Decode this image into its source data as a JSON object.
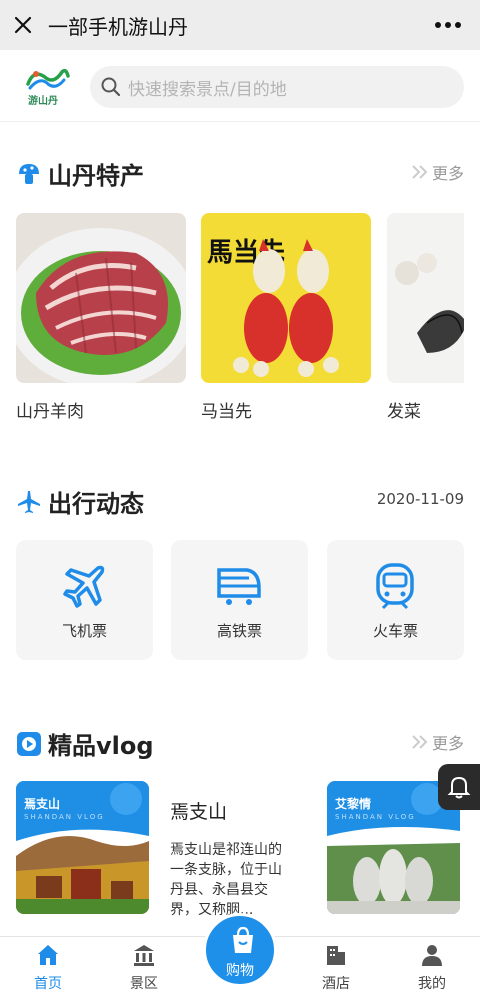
{
  "titlebar": {
    "title": "一部手机游山丹"
  },
  "search": {
    "logo_text": "游山丹",
    "placeholder": "快速搜索景点/目的地"
  },
  "specialty": {
    "title": "山丹特产",
    "more": "更多",
    "items": [
      {
        "name": "山丹羊肉"
      },
      {
        "name": "马当先",
        "image_text": "馬当先"
      },
      {
        "name": "发菜"
      }
    ]
  },
  "travel": {
    "title": "出行动态",
    "date": "2020-11-09",
    "items": [
      {
        "label": "飞机票",
        "icon": "airplane-icon"
      },
      {
        "label": "高铁票",
        "icon": "bullet-train-icon"
      },
      {
        "label": "火车票",
        "icon": "train-icon"
      }
    ]
  },
  "vlog": {
    "title": "精品vlog",
    "more": "更多",
    "cards": [
      {
        "badge": "焉支山",
        "sub": "SHANDAN VLOG",
        "title": "焉支山",
        "desc": "焉支山是祁连山的一条支脉，位于山丹县、永昌县交界，又称胭..."
      },
      {
        "badge": "艾黎情",
        "sub": "SHANDAN VLOG"
      }
    ]
  },
  "tabs": [
    {
      "label": "首页",
      "icon": "home-icon"
    },
    {
      "label": "景区",
      "icon": "scenic-icon"
    },
    {
      "label": "购物",
      "icon": "shopping-bag-icon"
    },
    {
      "label": "酒店",
      "icon": "hotel-icon"
    },
    {
      "label": "我的",
      "icon": "user-icon"
    }
  ],
  "colors": {
    "accent": "#1e8ce8",
    "titlebar_bg": "#ededed",
    "card_bg": "#f5f5f5"
  }
}
